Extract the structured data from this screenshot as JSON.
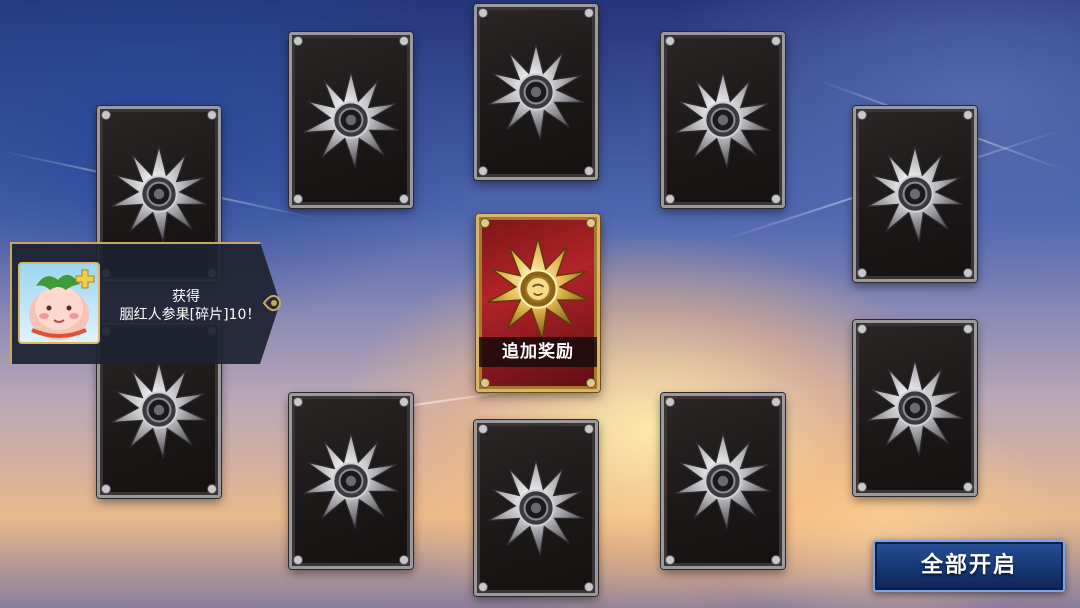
{
  "toast": {
    "title": "获得",
    "message": "胭红人参果[碎片]10！"
  },
  "bonus_card": {
    "label": "追加奖励"
  },
  "buttons": {
    "open_all": "全部开启"
  },
  "colors": {
    "card_frame": "#9a9a9e",
    "bonus_frame": "#d8b56a",
    "bonus_bg": "#b3232a",
    "button_bg": "#163775"
  }
}
